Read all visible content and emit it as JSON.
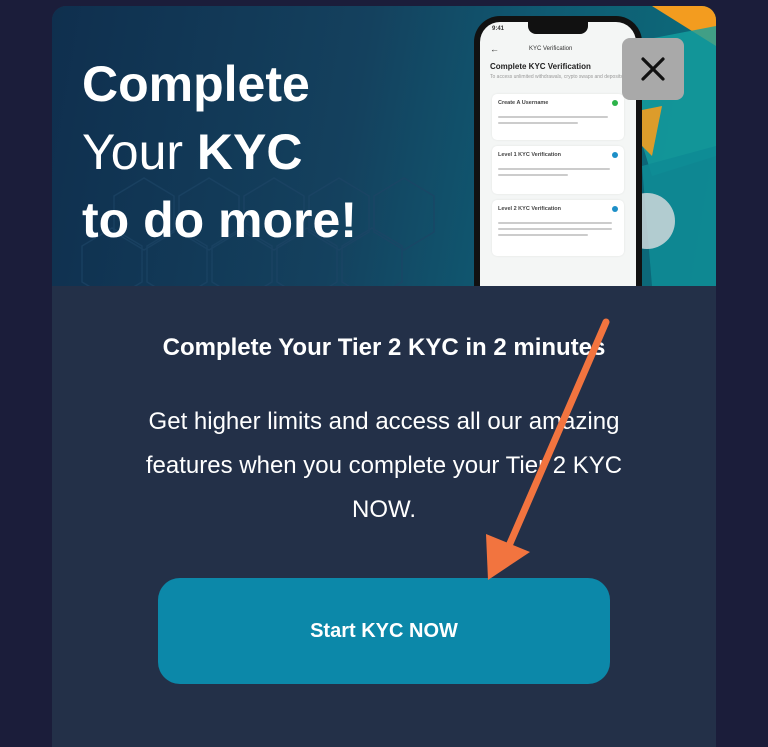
{
  "banner": {
    "headline_line1": "Complete",
    "headline_line2_a": "Your ",
    "headline_line2_b": "KYC",
    "headline_line3": "to do more!",
    "phone": {
      "time": "9:41",
      "nav_title": "KYC Verification",
      "heading": "Complete KYC Verification",
      "subtitle": "To access unlimited withdrawals, crypto swaps and deposits",
      "cards": [
        {
          "title": "Create A Username",
          "dot_color": "#2db34a"
        },
        {
          "title": "Level 1 KYC Verification",
          "dot_color": "#1d8fc7"
        },
        {
          "title": "Level 2 KYC Verification",
          "dot_color": "#1d8fc7"
        }
      ]
    }
  },
  "close": {
    "icon": "close-icon"
  },
  "content": {
    "title": "Complete Your Tier 2 KYC in 2 minutes",
    "description_line1": "Get higher limits and access all our amazing",
    "description_line2": "features when you complete your Tier 2 KYC",
    "description_line3": "NOW."
  },
  "cta": {
    "label": "Start KYC NOW"
  },
  "colors": {
    "background": "#1b1d3a",
    "modal": "#233048",
    "button": "#0c88a9",
    "annotation_arrow": "#f2743f",
    "close_button": "#a9a9a9"
  }
}
